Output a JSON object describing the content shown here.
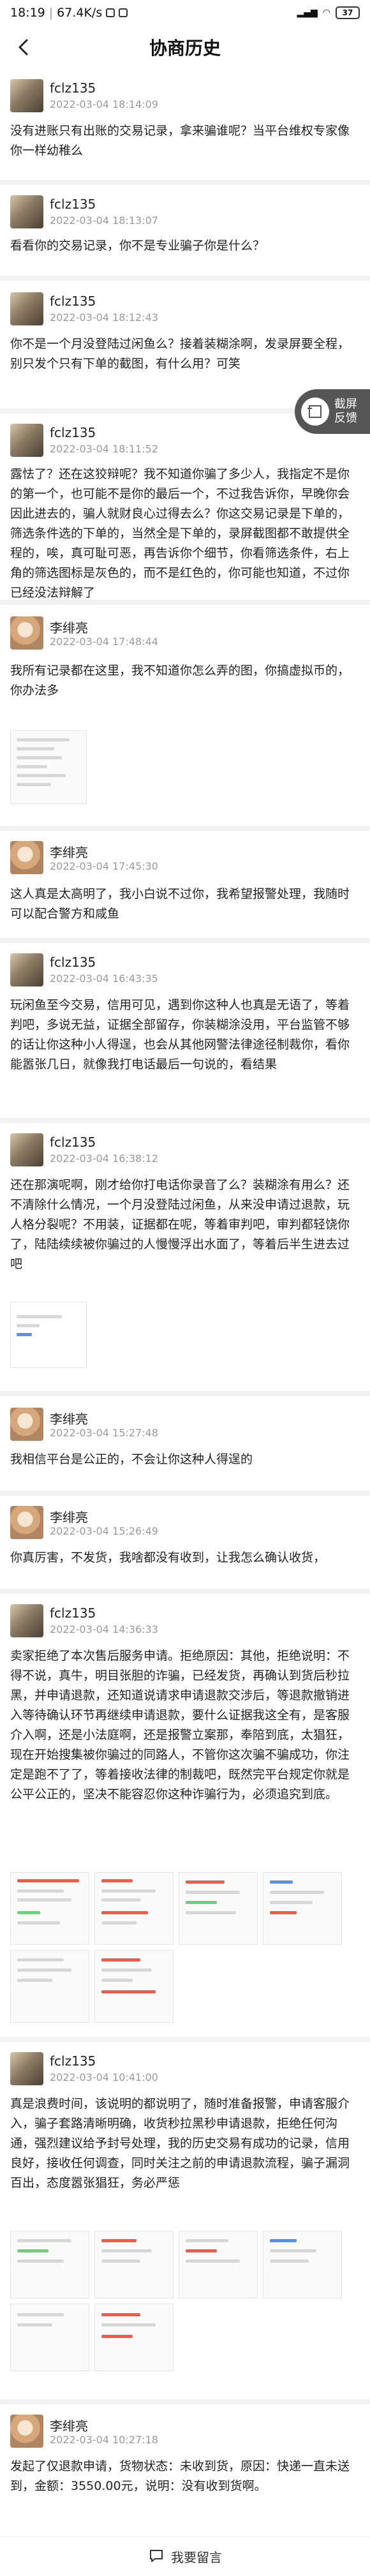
{
  "status_bar": {
    "time": "18:19",
    "speed": "67.4K/s",
    "battery": "37"
  },
  "header": {
    "title": "协商历史"
  },
  "float_button": {
    "label_line1": "截屏",
    "label_line2": "反馈"
  },
  "entries": [
    {
      "user": "fclz135",
      "time": "2022-03-04 18:14:09",
      "text": "没有进账只有出账的交易记录，拿来骗谁呢？当平台维权专家像你一样幼稚么"
    },
    {
      "user": "fclz135",
      "time": "2022-03-04 18:13:07",
      "text": "看看你的交易记录，你不是专业骗子你是什么？"
    },
    {
      "user": "fclz135",
      "time": "2022-03-04 18:12:43",
      "text": "你不是一个月没登陆过闲鱼么？接着装糊涂啊，发录屏要全程，别只发个只有下单的截图，有什么用？可笑"
    },
    {
      "user": "fclz135",
      "time": "2022-03-04 18:11:52",
      "text": "露怯了？还在这狡辩呢？我不知道你骗了多少人，我指定不是你的第一个，也可能不是你的最后一个，不过我告诉你，早晚你会因此进去的，骗人就财良心过得去么？你这交易记录是下单的，筛选条件选的下单的，当然全是下单的，录屏截图都不敢提供全程的，唉，真可耻可恶，再告诉你个细节，你看筛选条件，右上角的筛选图标是灰色的，而不是红色的，你可能也知道，不过你已经没法辩解了"
    },
    {
      "user": "李绯亮",
      "time": "2022-03-04 17:48:44",
      "text": "我所有记录都在这里，我不知道你怎么弄的图，你搞虚拟币的，你办法多"
    },
    {
      "user": "李绯亮",
      "time": "2022-03-04 17:45:30",
      "text": "这人真是太高明了，我小白说不过你，我希望报警处理，我随时可以配合警方和咸鱼"
    },
    {
      "user": "fclz135",
      "time": "2022-03-04 16:43:35",
      "text": "玩闲鱼至今交易，信用可见，遇到你这种人也真是无语了，等着判吧，多说无益，证据全部留存，你装糊涂没用，平台监管不够的话让你这种小人得逞，也会从其他网警法律途径制裁你，看你能嚣张几日，就像我打电话最后一句说的，看结果"
    },
    {
      "user": "fclz135",
      "time": "2022-03-04 16:38:12",
      "text": "还在那演呢啊，刚才给你打电话你录音了么？装糊涂有用么？还不清除什么情况，一个月没登陆过闲鱼，从来没申请过退款，玩人格分裂呢？不用装，证据都在呢，等着审判吧，审判都轻饶你了，陆陆续续被你骗过的人慢慢浮出水面了，等着后半生进去过吧"
    },
    {
      "user": "李绯亮",
      "time": "2022-03-04 15:27:48",
      "text": "我相信平台是公正的，不会让你这种人得逞的"
    },
    {
      "user": "李绯亮",
      "time": "2022-03-04 15:26:49",
      "text": "你真厉害，不发货，我啥都没有收到，让我怎么确认收货，"
    },
    {
      "user": "fclz135",
      "time": "2022-03-04 14:36:33",
      "text": "卖家拒绝了本次售后服务申请。拒绝原因：其他，拒绝说明：不得不说，真牛，明目张胆的诈骗，已经发货，再确认到货后秒拉黑，并申请退款，还知道说请求申请退款交涉后，等退款撤销进入等待确认环节再继续申请退款，要什么证据我这全有，是客服介入啊，还是小法庭啊，还是报警立案那，奉陪到底，太猖狂，现在开始搜集被你骗过的同路人，不管你这次骗不骗成功，你注定是跑不了了，等着接收法律的制裁吧，既然完平台规定你就是公平公正的，坚决不能容忍你这种诈骗行为，必须追究到底。"
    },
    {
      "user": "fclz135",
      "time": "2022-03-04 10:41:00",
      "text": "真是浪费时间，该说明的都说明了，随时准备报警，申请客服介入，骗子套路清晰明确，收货秒拉黑秒申请退款，拒绝任何沟通，强烈建议给予封号处理，我的历史交易有成功的记录，信用良好，接收任何调查，同时关注之前的申请退款流程，骗子漏洞百出，态度嚣张猖狂，务必严惩"
    },
    {
      "user": "李绯亮",
      "time": "2022-03-04 10:27:18",
      "text": "发起了仅退款申请，货物状态：未收到货，原因：快递一直未送到，金额：3550.00元，说明：没有收到货啊。"
    }
  ],
  "bottom_bar": {
    "label": "我要留言"
  }
}
